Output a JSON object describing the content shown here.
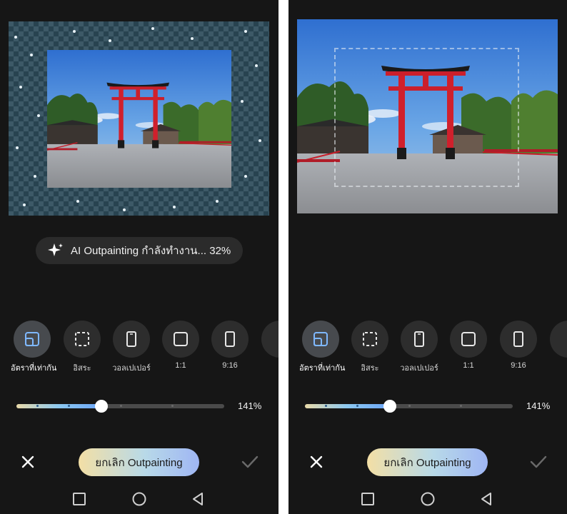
{
  "left_panel": {
    "progress": {
      "text": "AI Outpainting กำลังทำงาน... 32%",
      "value_percent": 32
    }
  },
  "ratio_options": [
    {
      "label": "อัตราที่เท่ากัน",
      "icon": "same-ratio-icon",
      "selected": true
    },
    {
      "label": "อิสระ",
      "icon": "free-crop-icon",
      "selected": false
    },
    {
      "label": "วอลเปเปอร์",
      "icon": "phone-wallpaper-icon",
      "selected": false
    },
    {
      "label": "1:1",
      "icon": "square-icon",
      "selected": false
    },
    {
      "label": "9:16",
      "icon": "portrait-rect-icon",
      "selected": false
    }
  ],
  "slider": {
    "value_label": "141%",
    "fill_fraction": 0.41
  },
  "actions": {
    "close_icon": "close-icon",
    "cancel_label": "ยกเลิก Outpainting",
    "confirm_icon": "check-icon"
  },
  "nav_bar": {
    "icons": [
      "square-icon",
      "circle-icon",
      "back-triangle-icon"
    ]
  },
  "colors": {
    "background": "#161616",
    "accent_slider": "#6aa4f7",
    "pill": "#2b2b2b"
  }
}
